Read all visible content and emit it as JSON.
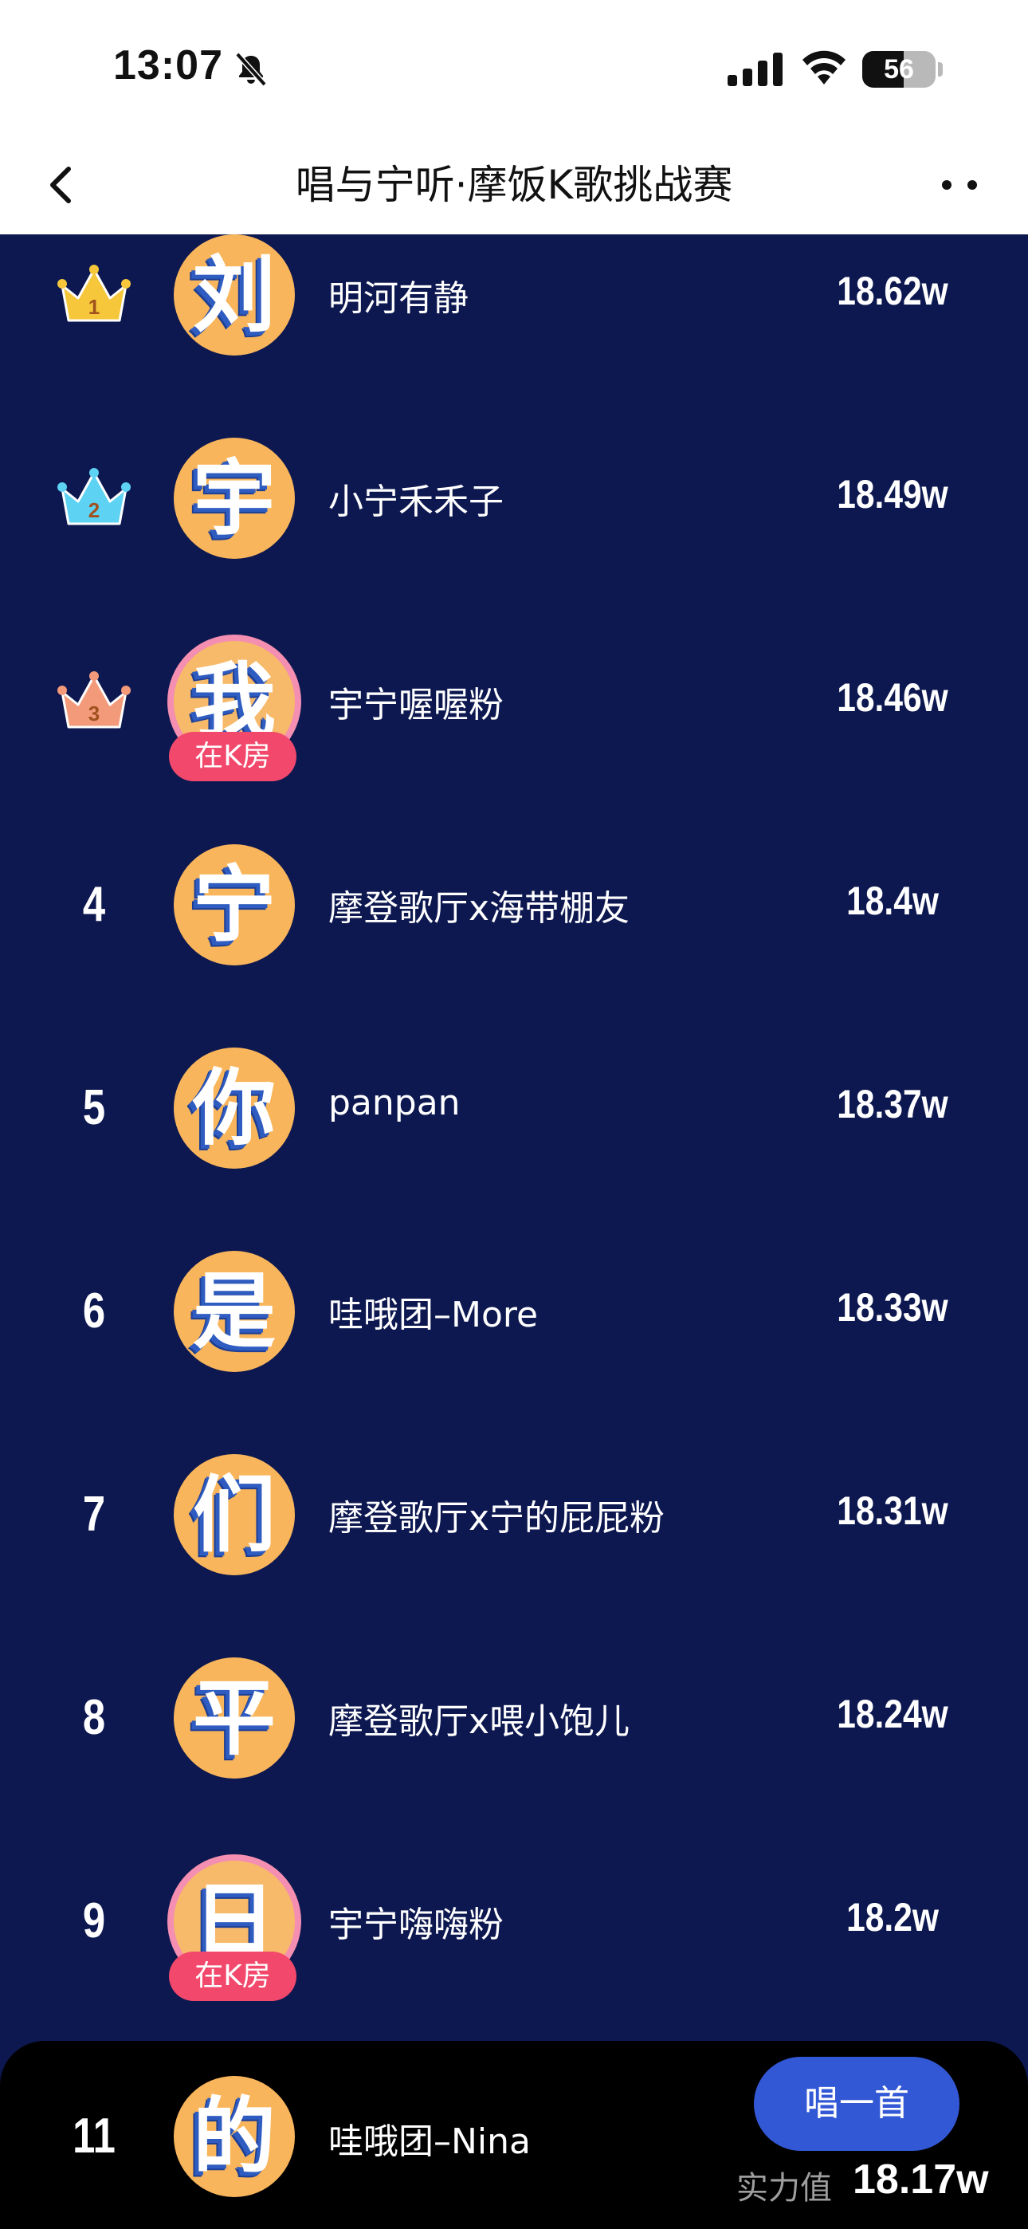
{
  "status_bar": {
    "time": "13:07",
    "battery": "56",
    "icons": [
      "bell-off-icon",
      "signal-icon",
      "wifi-icon",
      "battery-icon"
    ]
  },
  "nav": {
    "title": "唱与宁听·摩饭K歌挑战赛",
    "back_icon": "chevron-left-icon",
    "more_icon": "more-dots-icon"
  },
  "rankings": [
    {
      "rank": "1",
      "badge": "gold-crown",
      "avatar_char": "刘",
      "name": "明河有静",
      "score": "18.62w",
      "live": ""
    },
    {
      "rank": "2",
      "badge": "blue-crown",
      "avatar_char": "宇",
      "name": "小宁禾禾子",
      "score": "18.49w",
      "live": ""
    },
    {
      "rank": "3",
      "badge": "bronze-crown",
      "avatar_char": "我",
      "name": "宇宁喔喔粉",
      "score": "18.46w",
      "live": "在K房"
    },
    {
      "rank": "4",
      "badge": "",
      "avatar_char": "宁",
      "name": "摩登歌厅x海带棚友",
      "score": "18.4w",
      "live": ""
    },
    {
      "rank": "5",
      "badge": "",
      "avatar_char": "你",
      "name": "panpan",
      "score": "18.37w",
      "live": ""
    },
    {
      "rank": "6",
      "badge": "",
      "avatar_char": "是",
      "name": "哇哦团–More",
      "score": "18.33w",
      "live": ""
    },
    {
      "rank": "7",
      "badge": "",
      "avatar_char": "们",
      "name": "摩登歌厅x宁的屁屁粉",
      "score": "18.31w",
      "live": ""
    },
    {
      "rank": "8",
      "badge": "",
      "avatar_char": "平",
      "name": "摩登歌厅x喂小饱儿",
      "score": "18.24w",
      "live": ""
    },
    {
      "rank": "9",
      "badge": "",
      "avatar_char": "日",
      "name": "宇宁嗨嗨粉",
      "score": "18.2w",
      "live": "在K房"
    }
  ],
  "my_entry": {
    "rank": "11",
    "avatar_char": "的",
    "name": "哇哦团–Nina",
    "score_label": "实力值",
    "score": "18.17w",
    "sing_button": "唱一首"
  },
  "colors": {
    "background": "#0d1850",
    "avatar": "#f9b55b",
    "live_badge": "#f2486b",
    "sing_button": "#3358d6",
    "gold": "#f6c63b",
    "blue": "#5dd2f2",
    "bronze": "#f39a7a"
  }
}
